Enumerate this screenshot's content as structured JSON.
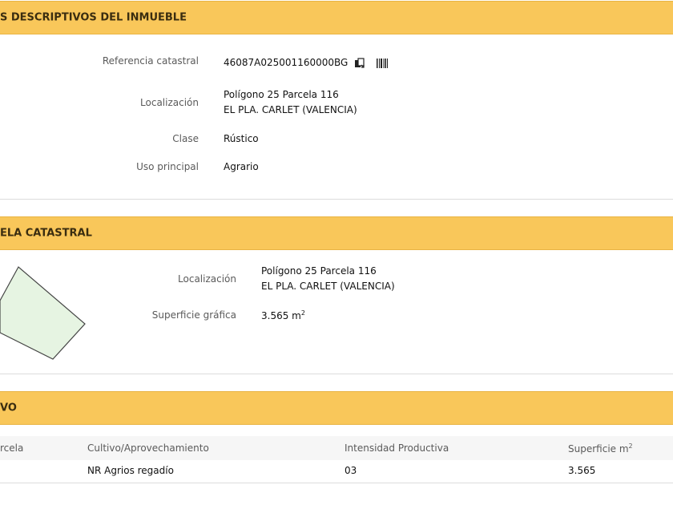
{
  "sections": {
    "descriptivos": {
      "title": "S DESCRIPTIVOS DEL INMUEBLE",
      "referencia_label": "Referencia catastral",
      "referencia_value": "46087A025001160000BG",
      "localizacion_label": "Localización",
      "localizacion_line1": "Polígono 25 Parcela 116",
      "localizacion_line2": "EL PLA. CARLET (VALENCIA)",
      "clase_label": "Clase",
      "clase_value": "Rústico",
      "uso_label": "Uso principal",
      "uso_value": "Agrario",
      "icons": [
        "copy-icon",
        "barcode-icon"
      ]
    },
    "parcela": {
      "title": "ELA CATASTRAL",
      "localizacion_label": "Localización",
      "localizacion_line1": "Polígono 25 Parcela 116",
      "localizacion_line2": "EL PLA. CARLET (VALENCIA)",
      "superficie_label": "Superficie gráfica",
      "superficie_value": "3.565 m",
      "superficie_sup": "2",
      "parcel_fill": "#e6f4e2",
      "parcel_stroke": "#444444"
    },
    "cultivo": {
      "title": "VO",
      "headers": {
        "col1": "rcela",
        "col2": "Cultivo/Aprovechamiento",
        "col3": "Intensidad Productiva",
        "col4": "Superficie m",
        "col4_sup": "2"
      },
      "rows": [
        {
          "col2": "NR Agrios regadío",
          "col3": "03",
          "col4": "3.565"
        }
      ]
    }
  },
  "colors": {
    "header_bg": "#f9c75a",
    "header_text": "#3a2d10",
    "label": "#5a5a5a"
  }
}
